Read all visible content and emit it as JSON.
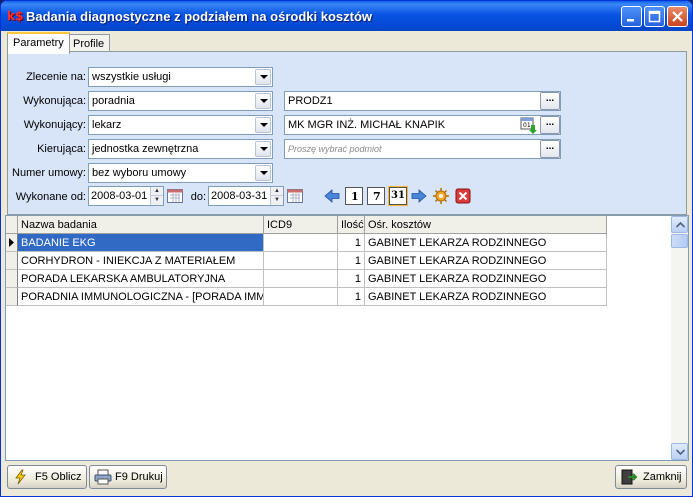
{
  "window": {
    "title": "Badania diagnostyczne z podziałem na ośrodki kosztów",
    "app_icon_glyph": "k$",
    "controls": [
      "minimize-icon",
      "maximize-icon",
      "close-icon"
    ]
  },
  "tabs": [
    {
      "label": "Parametry",
      "active": true
    },
    {
      "label": "Profile",
      "active": false
    }
  ],
  "params": {
    "zlecenie": {
      "label": "Zlecenie na:",
      "value": "wszystkie usługi"
    },
    "wykonujaca": {
      "label": "Wykonująca:",
      "value": "poradnia",
      "code": "PRODZ1"
    },
    "wykonujacy": {
      "label": "Wykonujący:",
      "value": "lekarz",
      "name": "MK MGR INŻ. MICHAŁ KNAPIK"
    },
    "kierujaca": {
      "label": "Kierująca:",
      "value": "jednostka zewnętrzna",
      "placeholder": "Proszę wybrać podmiot"
    },
    "umowa": {
      "label": "Numer umowy:",
      "value": "bez wyboru umowy"
    },
    "date_from_label": "Wykonane od:",
    "date_from": "2008-03-01",
    "date_to_label": "do:",
    "date_to": "2008-03-31",
    "dots": "...",
    "nav_buttons": [
      "back-arrow-icon",
      "day-1-icon",
      "week-7-icon",
      "month-31-icon",
      "forward-arrow-icon",
      "settings-gear-icon",
      "clear-delete-icon"
    ],
    "nav_labels": {
      "day": "1",
      "week": "7",
      "month": "31"
    }
  },
  "grid": {
    "columns": [
      "Nazwa badania",
      "ICD9",
      "Ilość",
      "Ośr. kosztów"
    ],
    "rows": [
      {
        "nazwa": "BADANIE EKG",
        "icd9": "",
        "ilosc": "1",
        "osrodek": "GABINET LEKARZA RODZINNEGO",
        "selected": true
      },
      {
        "nazwa": "CORHYDRON - INIEKCJA Z MATERIAŁEM",
        "icd9": "",
        "ilosc": "1",
        "osrodek": "GABINET LEKARZA RODZINNEGO",
        "selected": false
      },
      {
        "nazwa": "PORADA LEKARSKA AMBULATORYJNA",
        "icd9": "",
        "ilosc": "1",
        "osrodek": "GABINET LEKARZA RODZINNEGO",
        "selected": false
      },
      {
        "nazwa": "PORADNIA IMMUNOLOGICZNA - [PORADA IMMU",
        "icd9": "",
        "ilosc": "1",
        "osrodek": "GABINET LEKARZA RODZINNEGO",
        "selected": false
      }
    ]
  },
  "footer": {
    "oblicz": "F5 Oblicz",
    "drukuj": "F9 Drukuj",
    "zamknij": "Zamknij"
  },
  "colors": {
    "selection": "#316ac5",
    "titlebar": "#0854e3",
    "panel": "#d8e4f8"
  }
}
